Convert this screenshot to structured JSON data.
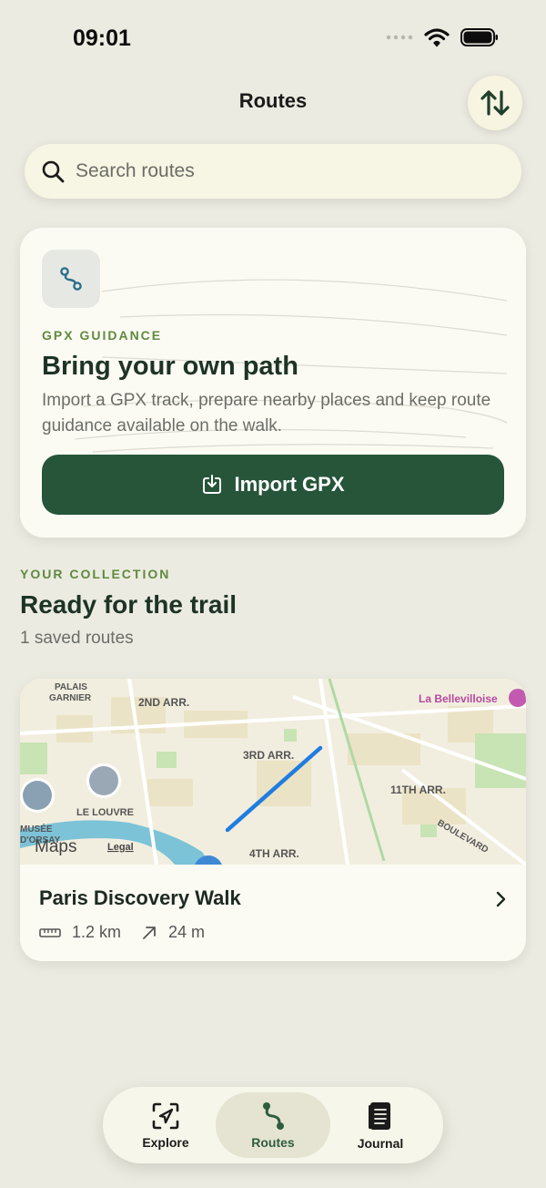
{
  "status_bar": {
    "time": "09:01"
  },
  "header": {
    "title": "Routes"
  },
  "icons": {
    "sort": "sort-arrows-icon",
    "search": "search-icon",
    "route": "route-path-icon",
    "import": "import-tray-icon",
    "distance": "ruler-icon",
    "elevation": "arrow-up-right-icon",
    "chevron": "chevron-right-icon"
  },
  "search": {
    "placeholder": "Search routes",
    "value": ""
  },
  "gpx_card": {
    "eyebrow": "GPX GUIDANCE",
    "title": "Bring your own path",
    "description": "Import a GPX track, prepare nearby places and keep route guidance available on the walk.",
    "button_label": "Import GPX"
  },
  "collection": {
    "eyebrow": "YOUR COLLECTION",
    "title": "Ready for the trail",
    "count_label": "1 saved routes"
  },
  "routes": [
    {
      "name": "Paris Discovery Walk",
      "distance": "1.2 km",
      "elevation": "24 m",
      "map": {
        "labels": [
          "PALAIS",
          "GARNIER",
          "2ND ARR.",
          "3RD ARR.",
          "11TH ARR.",
          "LE LOUVRE",
          "MUSÉE",
          "D'ORSAY",
          "4TH ARR.",
          "BOULEVARD",
          "La Bellevilloise"
        ],
        "attribution": "Maps",
        "legal": "Legal"
      }
    }
  ],
  "tabs": [
    {
      "label": "Explore",
      "active": false
    },
    {
      "label": "Routes",
      "active": true
    },
    {
      "label": "Journal",
      "active": false
    }
  ],
  "colors": {
    "accent": "#26553a",
    "eyebrow": "#5f8a3f",
    "background": "#ecebe1",
    "route_line": "#1f7de0"
  }
}
